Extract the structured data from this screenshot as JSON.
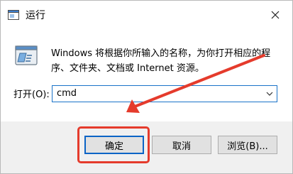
{
  "window": {
    "title": "运行"
  },
  "dialog": {
    "description": "Windows 将根据你所输入的名称，为你打开相应的程序、文件夹、文档或 Internet 资源。",
    "open_label": "打开(O):",
    "command_value": "cmd"
  },
  "buttons": {
    "ok": "确定",
    "cancel": "取消",
    "browse": "浏览(B)..."
  },
  "icons": {
    "app": "run-app-icon",
    "close": "close-icon",
    "run": "run-dialog-icon",
    "dropdown": "chevron-down-icon"
  },
  "colors": {
    "highlight": "#e53b2c",
    "focus_border": "#0a64c6",
    "footer_bg": "#f0f0f0"
  }
}
